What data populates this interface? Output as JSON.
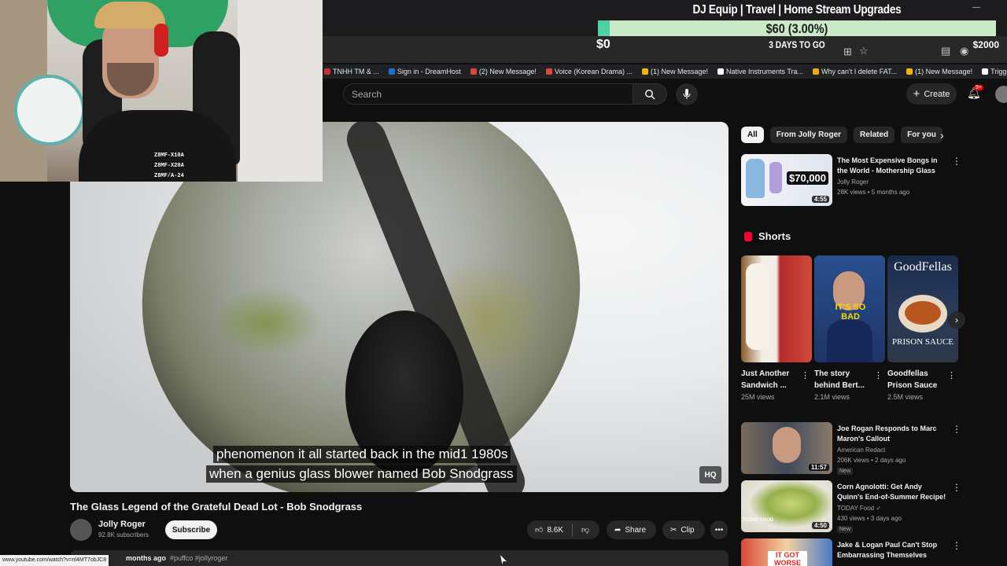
{
  "stream_goal": {
    "title": "DJ Equip | Travel | Home Stream Upgrades",
    "amount": "$60 (3.00%)",
    "progress_fraction": 0.03,
    "min": "$0",
    "days_left": "3 DAYS TO GO",
    "max": "$2000"
  },
  "webcam": {
    "shirt_text": [
      "Z8MF-X10A",
      "Z8MF-X20A",
      "Z8MF/A-24"
    ]
  },
  "bookmarks": [
    {
      "label": "TNHH TM & ...",
      "color": "#c9302c"
    },
    {
      "label": "Sign in - DreamHost",
      "color": "#1f6fd1"
    },
    {
      "label": "(2) New Message!",
      "color": "#e0473b"
    },
    {
      "label": "Voice (Korean Drama) ...",
      "color": "#e0473b"
    },
    {
      "label": "(1) New Message!",
      "color": "#f2b705"
    },
    {
      "label": "Native Instruments Tra...",
      "color": "#ffffff"
    },
    {
      "label": "Why can't I delete FAT...",
      "color": "#f2a900"
    },
    {
      "label": "(1) New Message!",
      "color": "#f2b705"
    },
    {
      "label": "Trigger Boxing",
      "color": "#ffffff"
    }
  ],
  "header": {
    "search_placeholder": "Search",
    "create_label": "Create",
    "notifications_badge": "9+"
  },
  "video": {
    "caption_line1": "phenomenon it all started back in the mid1 1980s",
    "caption_line2": "when a genius glass blower named Bob Snodgrass",
    "quality_badge": "HQ",
    "title": "The Glass Legend of the Grateful Dead Lot - Bob Snodgrass",
    "channel": "Jolly Roger",
    "subscribers": "92.8K subscribers",
    "subscribe_label": "Subscribe",
    "likes": "8.6K",
    "share_label": "Share",
    "clip_label": "Clip",
    "desc_date": "months ago",
    "desc_tags": "#puffco #jollyroger"
  },
  "status_url": "www.youtube.com/watch?v=nl4MT7obJC8",
  "sidebar": {
    "chips": [
      {
        "label": "All",
        "active": true
      },
      {
        "label": "From Jolly Roger",
        "active": false
      },
      {
        "label": "Related",
        "active": false
      },
      {
        "label": "For you",
        "active": false
      }
    ],
    "shorts_heading": "Shorts",
    "recommendations": [
      {
        "title": "The Most Expensive Bongs in the World - Mothership Glass",
        "channel": "Jolly Roger",
        "meta": "28K views • 5 months ago",
        "duration": "4:55",
        "thumb_text": "$70,000",
        "new": ""
      },
      {
        "title": "Joe Rogan Responds to Marc Maron's Callout",
        "channel": "American Redact",
        "meta": "206K views • 2 days ago",
        "duration": "11:57",
        "thumb_text": "",
        "new": "New"
      },
      {
        "title": "Corn Agnolotti: Get Andy Quinn's End-of-Summer Recipe!",
        "channel": "TODAY Food ✓",
        "meta": "430 views • 3 days ago",
        "duration": "4:50",
        "thumb_text": "TODAY FOOD",
        "new": "New"
      },
      {
        "title": "Jake & Logan Paul Can't Stop Embarrassing Themselves",
        "channel": "",
        "meta": "",
        "duration": "",
        "thumb_text": "IT GOT WORSE",
        "new": ""
      }
    ],
    "shorts": [
      {
        "title": "Just Another Sandwich ...",
        "views": "25M views",
        "thumb_text": ""
      },
      {
        "title": "The story behind Bert...",
        "views": "2.1M views",
        "thumb_text": "IT'S SO BAD"
      },
      {
        "title": "Goodfellas Prison Sauce",
        "views": "2.5M views",
        "thumb_text": "GoodFellas",
        "thumb_text2": "PRISON SAUCE"
      }
    ]
  }
}
